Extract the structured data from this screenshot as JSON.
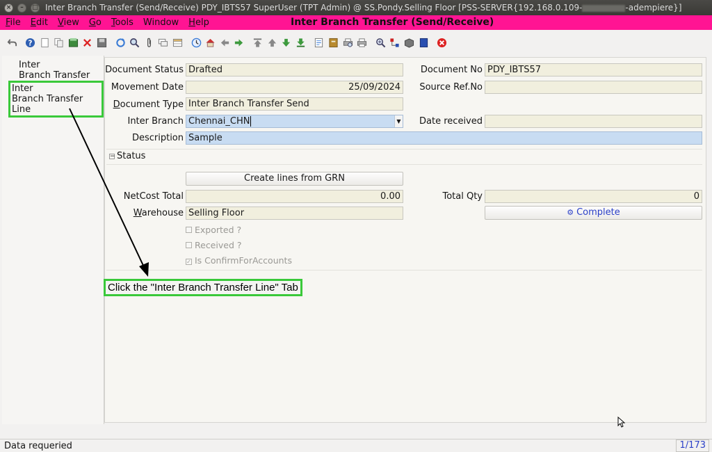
{
  "window": {
    "title": "Inter Branch Transfer (Send/Receive)  PDY_IBTS57  SuperUser (TPT Admin) @ SS.Pondy.Selling Floor [PSS-SERVER{192.168.0.109-",
    "title_suffix": "-adempiere}]"
  },
  "menu": {
    "items": [
      {
        "u": "F",
        "rest": "ile"
      },
      {
        "u": "E",
        "rest": "dit"
      },
      {
        "u": "V",
        "rest": "iew"
      },
      {
        "u": "G",
        "rest": "o"
      },
      {
        "u": "T",
        "rest": "ools"
      },
      {
        "u": "",
        "rest": "Window"
      },
      {
        "u": "H",
        "rest": "elp"
      }
    ],
    "window_title": "Inter Branch Transfer (Send/Receive)",
    "accent_color": "#ff1493"
  },
  "toolbar": {
    "icons": [
      "undo-icon",
      "help-icon",
      "new-record-icon",
      "copy-record-icon",
      "save-icon",
      "delete-icon",
      "save-disk-icon",
      "refresh-icon",
      "find-icon",
      "attachment-icon",
      "chat-icon",
      "grid-toggle-icon",
      "history-icon",
      "home-icon",
      "back-icon",
      "forward-icon",
      "first-record-icon",
      "previous-record-icon",
      "next-record-icon",
      "last-record-icon",
      "report-icon",
      "archive-icon",
      "print-preview-icon",
      "print-icon",
      "zoom-across-icon",
      "workflow-icon",
      "product-info-icon",
      "form-icon",
      "close-window-icon"
    ]
  },
  "tabs": [
    {
      "line1": "Inter",
      "line2": "Branch Transfer"
    },
    {
      "line1": "Inter",
      "line2": "Branch Transfer Line"
    }
  ],
  "form": {
    "document_status_label": "Document Status",
    "document_status_value": "Drafted",
    "document_no_label": "Document No",
    "document_no_value": "PDY_IBTS57",
    "movement_date_label": "Movement Date",
    "movement_date_value": "25/09/2024",
    "source_ref_label": "Source Ref.No",
    "source_ref_value": "",
    "document_type_label_u": "D",
    "document_type_label_rest": "ocument Type",
    "document_type_value": "Inter Branch Transfer Send",
    "inter_branch_label": "Inter Branch",
    "inter_branch_value": "Chennai_CHN",
    "date_received_label": "Date received",
    "date_received_value": "",
    "description_label": "Description",
    "description_value": "Sample",
    "status_section": "Status",
    "create_lines_button": "Create lines from GRN",
    "netcost_label": "NetCost Total",
    "netcost_value": "0.00",
    "total_qty_label": "Total Qty",
    "total_qty_value": "0",
    "warehouse_label_u": "W",
    "warehouse_label_rest": "arehouse",
    "warehouse_value": "Selling Floor",
    "complete_button": "Complete",
    "exported_label": "Exported ?",
    "received_label": "Received ?",
    "confirm_accounts_label": "Is ConfirmForAccounts"
  },
  "callout": {
    "text": "Click the \"Inter Branch Transfer Line\" Tab",
    "highlight_color": "#3ac93a"
  },
  "statusbar": {
    "message": "Data requeried",
    "record_count": "1/173"
  }
}
